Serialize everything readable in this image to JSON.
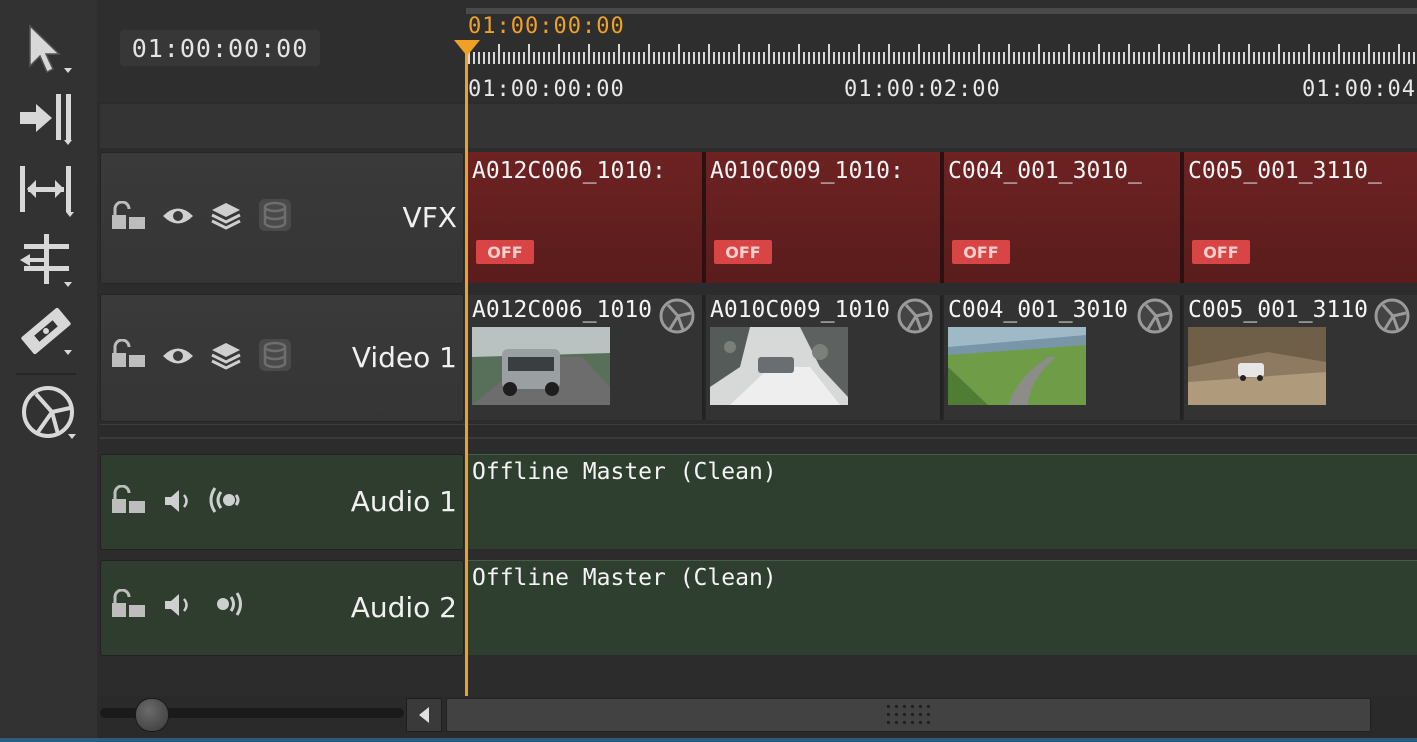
{
  "timecode_display": "01:00:00:00",
  "ruler": {
    "playhead_timecode": "01:00:00:00",
    "labels": [
      "01:00:00:00",
      "01:00:02:00",
      "01:00:04"
    ]
  },
  "tools": [
    {
      "name": "select-tool-icon"
    },
    {
      "name": "track-forward-icon"
    },
    {
      "name": "slip-tool-icon"
    },
    {
      "name": "ripple-tool-icon"
    },
    {
      "name": "razor-tool-icon"
    },
    {
      "name": "soft-effects-icon"
    }
  ],
  "tracks": {
    "vfx": {
      "name": "VFX"
    },
    "video1": {
      "name": "Video 1"
    },
    "audio1": {
      "name": "Audio 1"
    },
    "audio2": {
      "name": "Audio 2"
    }
  },
  "vfx_clips": [
    {
      "title": "A012C006_1010:",
      "badge": "OFF"
    },
    {
      "title": "A010C009_1010:",
      "badge": "OFF"
    },
    {
      "title": "C004_001_3010_",
      "badge": "OFF"
    },
    {
      "title": "C005_001_3110_",
      "badge": "OFF"
    }
  ],
  "video_clips": [
    {
      "title": "A012C006_1010"
    },
    {
      "title": "A010C009_1010"
    },
    {
      "title": "C004_001_3010"
    },
    {
      "title": "C005_001_3110"
    }
  ],
  "audio_clips": {
    "audio1": "Offline Master (Clean)",
    "audio2": "Offline Master (Clean)"
  },
  "colors": {
    "playhead": "#f0a025",
    "vfx_clip": "#6e2222",
    "audio_lane": "#2f3f2f",
    "off_badge": "#d94444"
  }
}
